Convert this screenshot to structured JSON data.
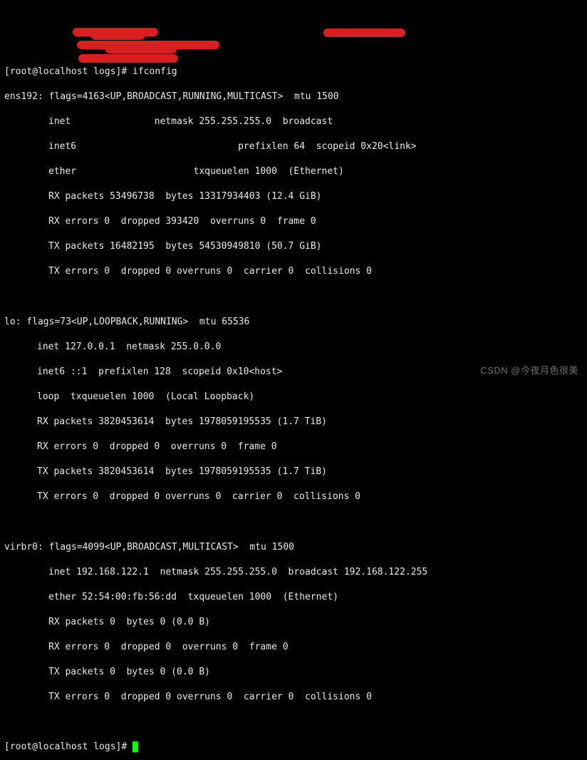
{
  "prompt1": "[root@localhost logs]# ",
  "command": "ifconfig",
  "ifaces": {
    "ens192": {
      "header": "ens192: flags=4163<UP,BROADCAST,RUNNING,MULTICAST>  mtu 1500",
      "inet": "inet               netmask 255.255.255.0  broadcast         ",
      "inet6": "inet6                             prefixlen 64  scopeid 0x20<link>",
      "ether": "ether                     txqueuelen 1000  (Ethernet)",
      "rx_packets": "RX packets 53496738  bytes 13317934403 (12.4 GiB)",
      "rx_errors": "RX errors 0  dropped 393420  overruns 0  frame 0",
      "tx_packets": "TX packets 16482195  bytes 54530949810 (50.7 GiB)",
      "tx_errors": "TX errors 0  dropped 0 overruns 0  carrier 0  collisions 0"
    },
    "lo": {
      "header": "lo: flags=73<UP,LOOPBACK,RUNNING>  mtu 65536",
      "inet": "inet 127.0.0.1  netmask 255.0.0.0",
      "inet6": "inet6 ::1  prefixlen 128  scopeid 0x10<host>",
      "loop": "loop  txqueuelen 1000  (Local Loopback)",
      "rx_packets": "RX packets 3820453614  bytes 1978059195535 (1.7 TiB)",
      "rx_errors": "RX errors 0  dropped 0  overruns 0  frame 0",
      "tx_packets": "TX packets 3820453614  bytes 1978059195535 (1.7 TiB)",
      "tx_errors": "TX errors 0  dropped 0 overruns 0  carrier 0  collisions 0"
    },
    "virbr0": {
      "header": "virbr0: flags=4099<UP,BROADCAST,MULTICAST>  mtu 1500",
      "inet": "inet 192.168.122.1  netmask 255.255.255.0  broadcast 192.168.122.255",
      "ether": "ether 52:54:00:fb:56:dd  txqueuelen 1000  (Ethernet)",
      "rx_packets": "RX packets 0  bytes 0 (0.0 B)",
      "rx_errors": "RX errors 0  dropped 0  overruns 0  frame 0",
      "tx_packets": "TX packets 0  bytes 0 (0.0 B)",
      "tx_errors": "TX errors 0  dropped 0 overruns 0  carrier 0  collisions 0"
    }
  },
  "prompt2": "[root@localhost logs]# ",
  "watermark": "CSDN @今夜月色很美"
}
